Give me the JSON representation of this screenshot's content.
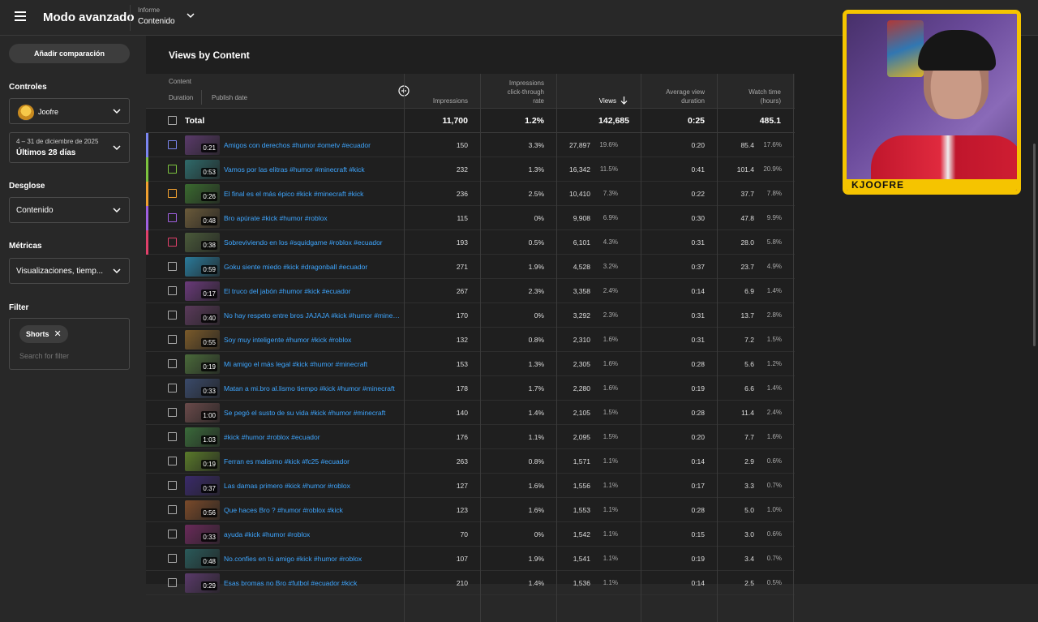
{
  "topbar": {
    "title": "Modo avanzado",
    "report_label": "Informe",
    "report_value": "Contenido"
  },
  "sidebar": {
    "compare_button": "Añadir comparación",
    "controls_label": "Controles",
    "channel_name": "Joofre",
    "date_range": "4 – 31 de diciembre de 2025",
    "date_preset": "Últimos 28 días",
    "breakdown_label": "Desglose",
    "breakdown_value": "Contenido",
    "metrics_label": "Métricas",
    "metrics_value": "Visualizaciones, tiemp...",
    "filter_label": "Filter",
    "filter_chip": "Shorts",
    "filter_placeholder": "Search for filter"
  },
  "main": {
    "title": "Views by Content"
  },
  "table": {
    "headers": {
      "content": "Content",
      "duration": "Duration",
      "publish_date": "Publish date",
      "impressions": "Impressions",
      "ctr": [
        "Impressions",
        "click-through",
        "rate"
      ],
      "views": "Views",
      "avd": [
        "Average view",
        "duration"
      ],
      "watch_time": [
        "Watch time",
        "(hours)"
      ]
    },
    "total": {
      "label": "Total",
      "impressions": "11,700",
      "ctr": "1.2%",
      "views": "142,685",
      "avd": "0:25",
      "watch_time": "485.1"
    },
    "rows": [
      {
        "dur": "0:21",
        "title": "Amigos con derechos #humor #ometv #ecuador",
        "imp": "150",
        "ctr": "3.3%",
        "views": "27,897",
        "vpct": "19.6%",
        "avd": "0:20",
        "wt": "85.4",
        "wpct": "17.6%",
        "accent": "#7b86f0",
        "cb": "#7b86f0",
        "thumb": "#5a3a6a"
      },
      {
        "dur": "0:53",
        "title": "Vamos por las elitras #humor #minecraft #kick",
        "imp": "232",
        "ctr": "1.3%",
        "views": "16,342",
        "vpct": "11.5%",
        "avd": "0:41",
        "wt": "101.4",
        "wpct": "20.9%",
        "accent": "#7dc33f",
        "cb": "#7dc33f",
        "thumb": "#2f6a6a"
      },
      {
        "dur": "0:26",
        "title": "El final es el más épico #kick #minecraft #kick",
        "imp": "236",
        "ctr": "2.5%",
        "views": "10,410",
        "vpct": "7.3%",
        "avd": "0:22",
        "wt": "37.7",
        "wpct": "7.8%",
        "accent": "#f0a030",
        "cb": "#f0a030",
        "thumb": "#3a6a2f"
      },
      {
        "dur": "0:48",
        "title": "Bro apúrate #kick #humor #roblox",
        "imp": "115",
        "ctr": "0%",
        "views": "9,908",
        "vpct": "6.9%",
        "avd": "0:30",
        "wt": "47.8",
        "wpct": "9.9%",
        "accent": "#a060e0",
        "cb": "#a060e0",
        "thumb": "#6a5a3a"
      },
      {
        "dur": "0:38",
        "title": "Sobreviviendo en los #squidgame #roblox #ecuador",
        "imp": "193",
        "ctr": "0.5%",
        "views": "6,101",
        "vpct": "4.3%",
        "avd": "0:31",
        "wt": "28.0",
        "wpct": "5.8%",
        "accent": "#e0406a",
        "cb": "#e0406a",
        "thumb": "#4a5a3a"
      },
      {
        "dur": "0:59",
        "title": "Goku siente miedo #kick #dragonball #ecuador",
        "imp": "271",
        "ctr": "1.9%",
        "views": "4,528",
        "vpct": "3.2%",
        "avd": "0:37",
        "wt": "23.7",
        "wpct": "4.9%",
        "accent": "",
        "cb": "#aaaaaa",
        "thumb": "#2a7a9a"
      },
      {
        "dur": "0:17",
        "title": "El truco del jabón #humor #kick #ecuador",
        "imp": "267",
        "ctr": "2.3%",
        "views": "3,358",
        "vpct": "2.4%",
        "avd": "0:14",
        "wt": "6.9",
        "wpct": "1.4%",
        "accent": "",
        "cb": "#aaaaaa",
        "thumb": "#6a3a7a"
      },
      {
        "dur": "0:40",
        "title": "No hay respeto entre bros JAJAJA #kick #humor #minecraft",
        "imp": "170",
        "ctr": "0%",
        "views": "3,292",
        "vpct": "2.3%",
        "avd": "0:31",
        "wt": "13.7",
        "wpct": "2.8%",
        "accent": "",
        "cb": "#aaaaaa",
        "thumb": "#5a3a5a"
      },
      {
        "dur": "0:55",
        "title": "Soy muy inteligente #humor #kick #roblox",
        "imp": "132",
        "ctr": "0.8%",
        "views": "2,310",
        "vpct": "1.6%",
        "avd": "0:31",
        "wt": "7.2",
        "wpct": "1.5%",
        "accent": "",
        "cb": "#aaaaaa",
        "thumb": "#7a5a2a"
      },
      {
        "dur": "0:19",
        "title": "Mi amigo el más legal #kick #humor #minecraft",
        "imp": "153",
        "ctr": "1.3%",
        "views": "2,305",
        "vpct": "1.6%",
        "avd": "0:28",
        "wt": "5.6",
        "wpct": "1.2%",
        "accent": "",
        "cb": "#aaaaaa",
        "thumb": "#4a6a3a"
      },
      {
        "dur": "0:33",
        "title": "Matan a mi.bro al.lismo tiempo #kick #humor #minecraft",
        "imp": "178",
        "ctr": "1.7%",
        "views": "2,280",
        "vpct": "1.6%",
        "avd": "0:19",
        "wt": "6.6",
        "wpct": "1.4%",
        "accent": "",
        "cb": "#aaaaaa",
        "thumb": "#3a4a6a"
      },
      {
        "dur": "1:00",
        "title": "Se pegó el susto de su vida #kick #humor #minecraft",
        "imp": "140",
        "ctr": "1.4%",
        "views": "2,105",
        "vpct": "1.5%",
        "avd": "0:28",
        "wt": "11.4",
        "wpct": "2.4%",
        "accent": "",
        "cb": "#aaaaaa",
        "thumb": "#6a4a4a"
      },
      {
        "dur": "1:03",
        "title": "#kick #humor #roblox #ecuador",
        "imp": "176",
        "ctr": "1.1%",
        "views": "2,095",
        "vpct": "1.5%",
        "avd": "0:20",
        "wt": "7.7",
        "wpct": "1.6%",
        "accent": "",
        "cb": "#aaaaaa",
        "thumb": "#3a6a3a"
      },
      {
        "dur": "0:19",
        "title": "Ferran es malisimo #kick #fc25 #ecuador",
        "imp": "263",
        "ctr": "0.8%",
        "views": "1,571",
        "vpct": "1.1%",
        "avd": "0:14",
        "wt": "2.9",
        "wpct": "0.6%",
        "accent": "",
        "cb": "#aaaaaa",
        "thumb": "#5a7a2a"
      },
      {
        "dur": "0:37",
        "title": "Las damas primero #kick #humor #roblox",
        "imp": "127",
        "ctr": "1.6%",
        "views": "1,556",
        "vpct": "1.1%",
        "avd": "0:17",
        "wt": "3.3",
        "wpct": "0.7%",
        "accent": "",
        "cb": "#aaaaaa",
        "thumb": "#3a2a6a"
      },
      {
        "dur": "0:56",
        "title": "Que haces Bro ? #humor #roblox #kick",
        "imp": "123",
        "ctr": "1.6%",
        "views": "1,553",
        "vpct": "1.1%",
        "avd": "0:28",
        "wt": "5.0",
        "wpct": "1.0%",
        "accent": "",
        "cb": "#aaaaaa",
        "thumb": "#7a4a2a"
      },
      {
        "dur": "0:33",
        "title": "ayuda #kick #humor #roblox",
        "imp": "70",
        "ctr": "0%",
        "views": "1,542",
        "vpct": "1.1%",
        "avd": "0:15",
        "wt": "3.0",
        "wpct": "0.6%",
        "accent": "",
        "cb": "#aaaaaa",
        "thumb": "#6a2a5a"
      },
      {
        "dur": "0:48",
        "title": "No.confies en tú amigo #kick #humor #roblox",
        "imp": "107",
        "ctr": "1.9%",
        "views": "1,541",
        "vpct": "1.1%",
        "avd": "0:19",
        "wt": "3.4",
        "wpct": "0.7%",
        "accent": "",
        "cb": "#aaaaaa",
        "thumb": "#2a5a5a"
      },
      {
        "dur": "0:29",
        "title": "Esas bromas no Bro #futbol #ecuador #kick",
        "imp": "210",
        "ctr": "1.4%",
        "views": "1,536",
        "vpct": "1.1%",
        "avd": "0:14",
        "wt": "2.5",
        "wpct": "0.5%",
        "accent": "",
        "cb": "#aaaaaa",
        "thumb": "#5a3a6a"
      }
    ]
  },
  "webcam": {
    "label": "KJOOFRE"
  },
  "colors": {
    "link": "#3ea6ff",
    "webcam_frame": "#f5c400"
  }
}
